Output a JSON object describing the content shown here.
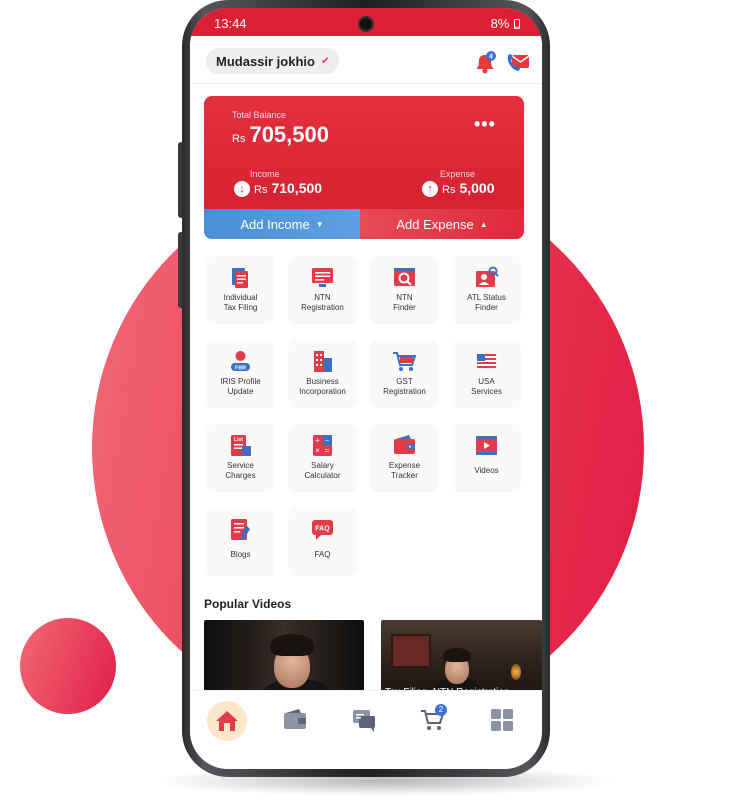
{
  "status_bar": {
    "time": "13:44",
    "battery": "8%"
  },
  "header": {
    "user_name": "Mudassir jokhio",
    "notification_count": "4"
  },
  "balance": {
    "total_label": "Total Balance",
    "currency": "Rs",
    "total_amount": "705,500",
    "income_label": "Income",
    "income_amount": "710,500",
    "expense_label": "Expense",
    "expense_amount": "5,000",
    "add_income_label": "Add Income",
    "add_expense_label": "Add Expense"
  },
  "services": [
    {
      "line1": "Individual",
      "line2": "Tax Filing",
      "icon": "tax-document-icon"
    },
    {
      "line1": "NTN",
      "line2": "Registration",
      "icon": "ntn-registration-icon"
    },
    {
      "line1": "NTN",
      "line2": "Finder",
      "icon": "ntn-finder-icon"
    },
    {
      "line1": "ATL Status",
      "line2": "Finder",
      "icon": "atl-status-icon"
    },
    {
      "line1": "IRIS Profile",
      "line2": "Update",
      "icon": "iris-profile-icon",
      "tag": "FBR"
    },
    {
      "line1": "Business",
      "line2": "Incorporation",
      "icon": "business-building-icon"
    },
    {
      "line1": "GST",
      "line2": "Registration",
      "icon": "gst-cart-icon"
    },
    {
      "line1": "USA",
      "line2": "Services",
      "icon": "usa-flag-icon"
    },
    {
      "line1": "Service",
      "line2": "Charges",
      "icon": "service-charges-icon",
      "tag": "List"
    },
    {
      "line1": "Salary",
      "line2": "Calculator",
      "icon": "calculator-icon"
    },
    {
      "line1": "Expense",
      "line2": "Tracker",
      "icon": "wallet-icon"
    },
    {
      "line1": "Videos",
      "line2": "",
      "icon": "video-player-icon"
    },
    {
      "line1": "Blogs",
      "line2": "",
      "icon": "blog-icon"
    },
    {
      "line1": "FAQ",
      "line2": "",
      "icon": "faq-icon",
      "tag": "FAQ"
    }
  ],
  "popular_videos": {
    "title": "Popular Videos",
    "items": [
      {
        "caption": ""
      },
      {
        "caption": "Tax Filing, NTN Registration"
      }
    ]
  },
  "bottom_nav": {
    "items": [
      "home-icon",
      "wallet-icon",
      "chat-icon",
      "cart-icon",
      "grid-icon"
    ],
    "cart_badge": "2"
  },
  "colors": {
    "brand_red": "#dc1f33",
    "income_blue": "#4a8fd6",
    "background_blob": "#e8334f"
  }
}
